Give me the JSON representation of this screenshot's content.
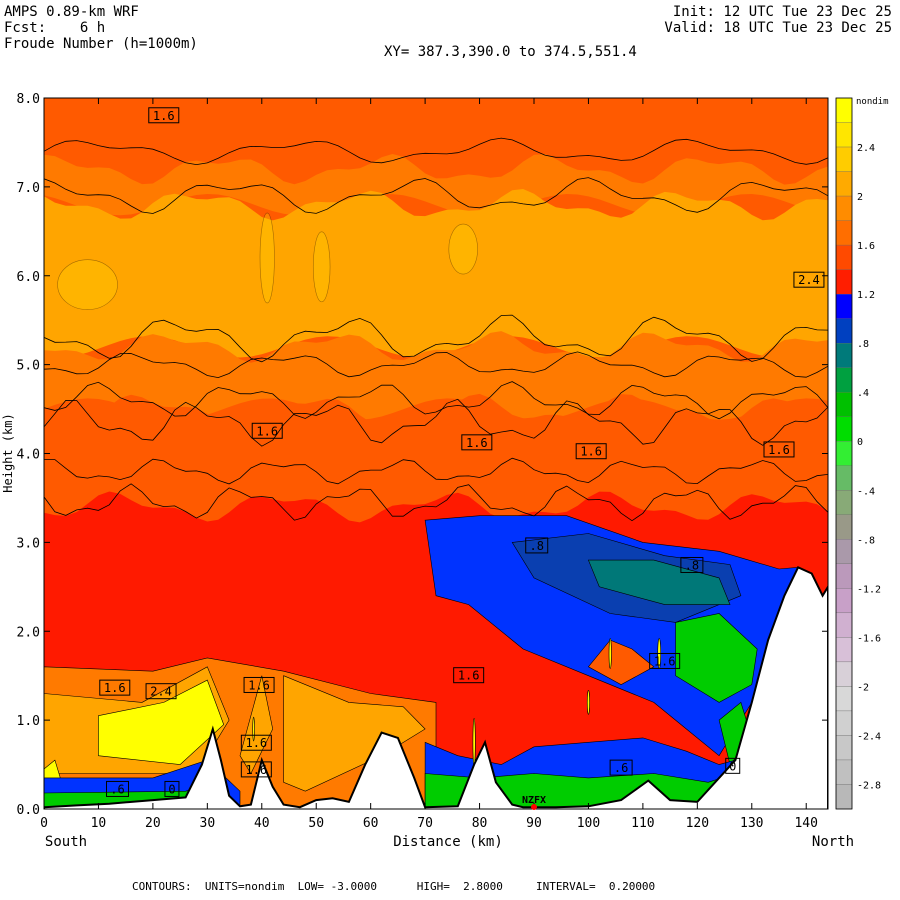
{
  "header": {
    "line1": "AMPS 0.89-km WRF",
    "fcst_label": "Fcst:",
    "fcst_value": "6 h",
    "field_name": "Froude Number (h=1000m)",
    "init": "Init: 12 UTC Tue 23 Dec 25",
    "valid": "Valid: 18 UTC Tue 23 Dec 25",
    "xy": "XY= 387.3,390.0 to 374.5,551.4"
  },
  "footer": {
    "text": "CONTOURS:  UNITS=nondim  LOW= -3.0000      HIGH=  2.8000     INTERVAL=  0.20000"
  },
  "colors": {
    "yellow": "#ffff00",
    "gold": "#ffd000",
    "light_orange": "#ffa500",
    "orange": "#ff7a00",
    "dark_orange": "#ff5a00",
    "red": "#ff1a00",
    "blue": "#0033ff",
    "mid_blue": "#0a3fb0",
    "teal": "#007878",
    "green": "#00cc00",
    "terrain": "#ffffff"
  },
  "chart_data": {
    "type": "heatmap",
    "title": "Froude Number (h=1000m)",
    "xlabel": "Distance (km)",
    "ylabel": "Height (km)",
    "xlim": [
      0,
      144
    ],
    "ylim": [
      0,
      8
    ],
    "x_ticks": [
      0,
      10,
      20,
      30,
      40,
      50,
      60,
      70,
      80,
      90,
      100,
      110,
      120,
      130,
      140
    ],
    "y_ticks": [
      "0.0",
      "1.0",
      "2.0",
      "3.0",
      "4.0",
      "5.0",
      "6.0",
      "7.0",
      "8.0"
    ],
    "x_end_labels": {
      "left": "South",
      "right": "North"
    },
    "colorbar": {
      "unit": "nondim",
      "labels": [
        "2.4",
        "2",
        "1.6",
        "1.2",
        ".8",
        ".4",
        "0",
        "-.4",
        "-.8",
        "-1.2",
        "-1.6",
        "-2",
        "-2.4",
        "-2.8"
      ],
      "label_values": [
        2.4,
        2.0,
        1.6,
        1.2,
        0.8,
        0.4,
        0.0,
        -0.4,
        -0.8,
        -1.2,
        -1.6,
        -2.0,
        -2.4,
        -2.8
      ],
      "bins": [
        {
          "from": 2.6,
          "to": 2.8,
          "color": "#ffff00"
        },
        {
          "from": 2.4,
          "to": 2.6,
          "color": "#ffe600"
        },
        {
          "from": 2.2,
          "to": 2.4,
          "color": "#ffcc00"
        },
        {
          "from": 2.0,
          "to": 2.2,
          "color": "#ffaa00"
        },
        {
          "from": 1.8,
          "to": 2.0,
          "color": "#ff8c00"
        },
        {
          "from": 1.6,
          "to": 1.8,
          "color": "#ff6e00"
        },
        {
          "from": 1.4,
          "to": 1.6,
          "color": "#ff4a00"
        },
        {
          "from": 1.2,
          "to": 1.4,
          "color": "#ff1e00"
        },
        {
          "from": 1.0,
          "to": 1.2,
          "color": "#0000ff"
        },
        {
          "from": 0.8,
          "to": 1.0,
          "color": "#0040c0"
        },
        {
          "from": 0.6,
          "to": 0.8,
          "color": "#007a7a"
        },
        {
          "from": 0.4,
          "to": 0.6,
          "color": "#00a040"
        },
        {
          "from": 0.2,
          "to": 0.4,
          "color": "#00c000"
        },
        {
          "from": 0.0,
          "to": 0.2,
          "color": "#00dd00"
        },
        {
          "from": -0.2,
          "to": 0.0,
          "color": "#33ee33"
        },
        {
          "from": -0.4,
          "to": -0.2,
          "color": "#66bb66"
        },
        {
          "from": -0.6,
          "to": -0.4,
          "color": "#88aa77"
        },
        {
          "from": -0.8,
          "to": -0.6,
          "color": "#999988"
        },
        {
          "from": -1.0,
          "to": -0.8,
          "color": "#aa99aa"
        },
        {
          "from": -1.2,
          "to": -1.0,
          "color": "#bb99bb"
        },
        {
          "from": -1.4,
          "to": -1.2,
          "color": "#c8a0c8"
        },
        {
          "from": -1.6,
          "to": -1.4,
          "color": "#d0b0d0"
        },
        {
          "from": -1.8,
          "to": -1.6,
          "color": "#d8c0d8"
        },
        {
          "from": -2.0,
          "to": -1.8,
          "color": "#d8d0d8"
        },
        {
          "from": -2.2,
          "to": -2.0,
          "color": "#d8d8d8"
        },
        {
          "from": -2.4,
          "to": -2.2,
          "color": "#d0d0d0"
        },
        {
          "from": -2.6,
          "to": -2.4,
          "color": "#c8c8c8"
        },
        {
          "from": -2.8,
          "to": -2.6,
          "color": "#c0c0c0"
        },
        {
          "from": -3.0,
          "to": -2.8,
          "color": "#b8b8b8"
        }
      ]
    },
    "contour_labels": [
      {
        "text": "1.6",
        "x": 22,
        "y": 7.8
      },
      {
        "text": "2.4",
        "x": 140.5,
        "y": 5.95
      },
      {
        "text": "1.6",
        "x": 41,
        "y": 4.25
      },
      {
        "text": "1.6",
        "x": 79.5,
        "y": 4.12
      },
      {
        "text": "1.6",
        "x": 100.5,
        "y": 4.02
      },
      {
        "text": "1.6",
        "x": 135,
        "y": 4.04
      },
      {
        "text": ".8",
        "x": 90.5,
        "y": 2.96
      },
      {
        "text": ".8",
        "x": 119,
        "y": 2.74
      },
      {
        "text": "1.6",
        "x": 13,
        "y": 1.36
      },
      {
        "text": "2.4",
        "x": 21.5,
        "y": 1.32
      },
      {
        "text": "1.6",
        "x": 39.5,
        "y": 1.39
      },
      {
        "text": "1.6",
        "x": 78,
        "y": 1.5
      },
      {
        "text": "1.6",
        "x": 114,
        "y": 1.66
      },
      {
        "text": "1.6",
        "x": 39,
        "y": 0.74
      },
      {
        "text": "1.6",
        "x": 39,
        "y": 0.44
      },
      {
        "text": ".6",
        "x": 13.5,
        "y": 0.22
      },
      {
        "text": "0",
        "x": 23.5,
        "y": 0.22
      },
      {
        "text": ".6",
        "x": 106,
        "y": 0.46
      },
      {
        "text": "0",
        "x": 126.5,
        "y": 0.48
      }
    ],
    "terrain_label": {
      "text": "NZFX",
      "x": 90,
      "y": 0.1
    },
    "terrain_profile": [
      [
        0,
        0.02
      ],
      [
        6,
        0.04
      ],
      [
        12,
        0.06
      ],
      [
        20,
        0.1
      ],
      [
        26,
        0.13
      ],
      [
        29,
        0.5
      ],
      [
        31,
        0.9
      ],
      [
        32.5,
        0.55
      ],
      [
        34,
        0.15
      ],
      [
        36,
        0.03
      ],
      [
        38,
        0.05
      ],
      [
        40,
        0.55
      ],
      [
        42,
        0.25
      ],
      [
        44,
        0.05
      ],
      [
        47,
        0.02
      ],
      [
        50,
        0.1
      ],
      [
        53,
        0.12
      ],
      [
        56,
        0.08
      ],
      [
        59,
        0.5
      ],
      [
        62,
        0.86
      ],
      [
        65,
        0.8
      ],
      [
        68,
        0.35
      ],
      [
        70,
        0.02
      ],
      [
        76,
        0.03
      ],
      [
        79,
        0.5
      ],
      [
        81,
        0.75
      ],
      [
        83,
        0.3
      ],
      [
        86,
        0.05
      ],
      [
        88,
        0.02
      ],
      [
        94,
        0.02
      ],
      [
        100,
        0.03
      ],
      [
        106,
        0.1
      ],
      [
        111,
        0.32
      ],
      [
        115,
        0.1
      ],
      [
        120,
        0.08
      ],
      [
        124,
        0.35
      ],
      [
        127,
        0.55
      ],
      [
        130,
        1.2
      ],
      [
        133,
        1.9
      ],
      [
        136,
        2.4
      ],
      [
        138.5,
        2.72
      ],
      [
        141,
        2.65
      ],
      [
        143,
        2.4
      ],
      [
        144,
        2.5
      ]
    ]
  }
}
